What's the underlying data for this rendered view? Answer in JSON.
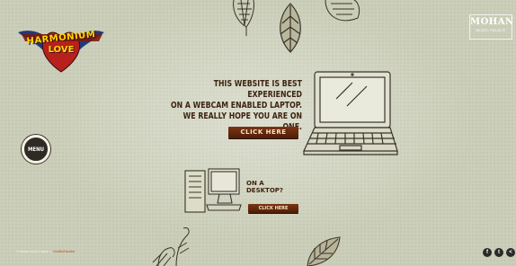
{
  "logo": {
    "line1": "HARMONIUM",
    "line2": "LOVE"
  },
  "brand": {
    "name": "MOHAN",
    "subtitle": "MUSIC PALACE"
  },
  "menu": {
    "label": "MENU"
  },
  "hero": {
    "line1": "THIS WEBSITE IS BEST EXPERIENCED",
    "line2": "ON A WEBCAM ENABLED LAPTOP.",
    "line3": "WE REALLY HOPE YOU ARE ON ONE.",
    "cta_laptop": "CLICK HERE"
  },
  "desktop": {
    "line1": "ON A",
    "line2": "DESKTOP?",
    "cta": "CLICK HERE"
  },
  "footer": {
    "copyright": "© Mohan Music Palace",
    "credit": "Credits/Fashion"
  },
  "social": [
    {
      "icon": "facebook-icon",
      "glyph": "f"
    },
    {
      "icon": "twitter-icon",
      "glyph": "t"
    },
    {
      "icon": "share-icon",
      "glyph": "<"
    }
  ],
  "colors": {
    "background": "#cbcfb9",
    "text_brown": "#3e2410",
    "button_wood": "#6b2c10",
    "logo_red": "#b8201d",
    "logo_blue": "#1d3b7a"
  }
}
